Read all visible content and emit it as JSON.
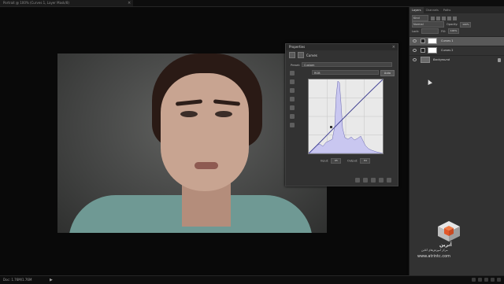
{
  "document": {
    "tab_title": "Portrait @ 100% (Curves 1, Layer Mask/8)",
    "tab_close": "×"
  },
  "status": {
    "zoom": "Doc: 1.76M/1.76M",
    "arrow": "▶"
  },
  "properties": {
    "title": "Properties",
    "close": "×",
    "panel_label": "Curves",
    "preset_label": "Preset:",
    "preset_value": "Custom",
    "channel_value": "RGB",
    "auto_label": "Auto",
    "input_label": "Input:",
    "input_value": "65",
    "output_label": "Output:",
    "output_value": "84"
  },
  "layers": {
    "tabs": [
      "Layers",
      "Channels",
      "Paths"
    ],
    "kind_label": "Kind",
    "blend_mode": "Normal",
    "opacity_label": "Opacity:",
    "opacity_value": "100%",
    "lock_label": "Lock:",
    "fill_label": "Fill:",
    "fill_value": "100%",
    "items": [
      {
        "name": "Curves 1"
      },
      {
        "name": "Curves 2"
      },
      {
        "name": "Background"
      }
    ]
  },
  "watermark": {
    "title": "آترین",
    "subtitle": "مرکز آموزش‌های آنلاین",
    "url": "www.atrintc.com"
  },
  "colors": {
    "histogram_fill": "#c9c7f0",
    "curve_line": "#4a4a9a",
    "accent_orange": "#e2582a"
  },
  "icons": [
    "close-icon",
    "curves-icon",
    "eye-icon",
    "lock-icon",
    "cube-logo-icon"
  ]
}
